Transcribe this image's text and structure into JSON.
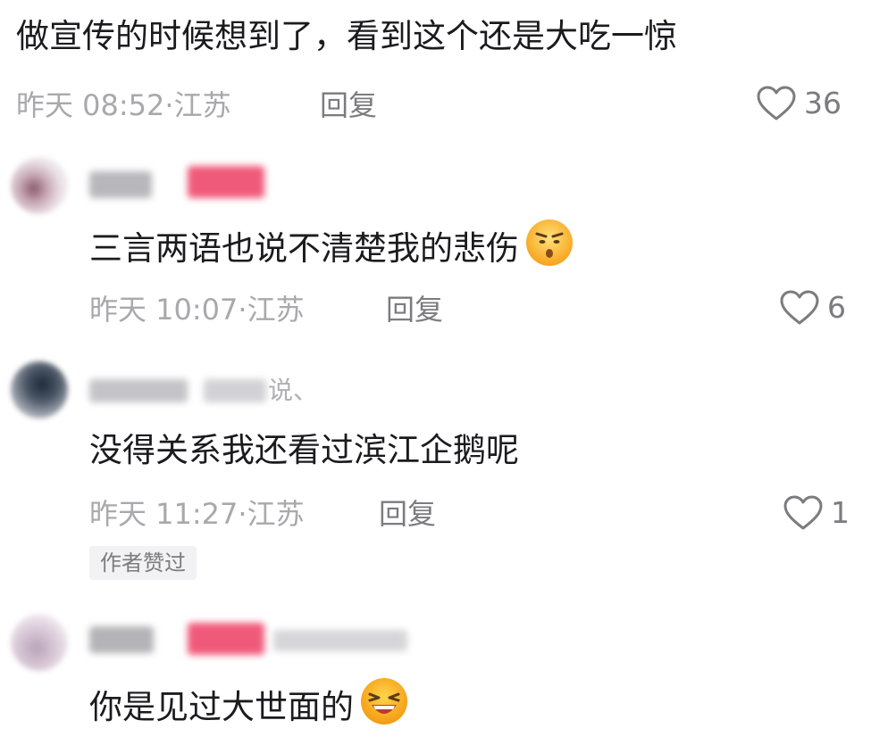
{
  "comments": [
    {
      "content": "做宣传的时候想到了，看到这个还是大吃一惊",
      "time": "昨天 08:52·江苏",
      "reply_label": "回复",
      "likes": "36"
    },
    {
      "content": "三言两语也说不清楚我的悲伤",
      "emoji": "hushed-face-emoji",
      "time": "昨天 10:07·江苏",
      "reply_label": "回复",
      "likes": "6"
    },
    {
      "username_suffix": "说、",
      "content": "没得关系我还看过滨江企鹅呢",
      "time": "昨天 11:27·江苏",
      "reply_label": "回复",
      "likes": "1",
      "author_liked": "作者赞过"
    },
    {
      "content": "你是见过大世面的",
      "emoji": "laughing-face-emoji"
    }
  ],
  "colors": {
    "text": "#1b1b1f",
    "meta": "#a9a9ad",
    "reply": "#7b7b80",
    "badge": "#fe2c55"
  }
}
